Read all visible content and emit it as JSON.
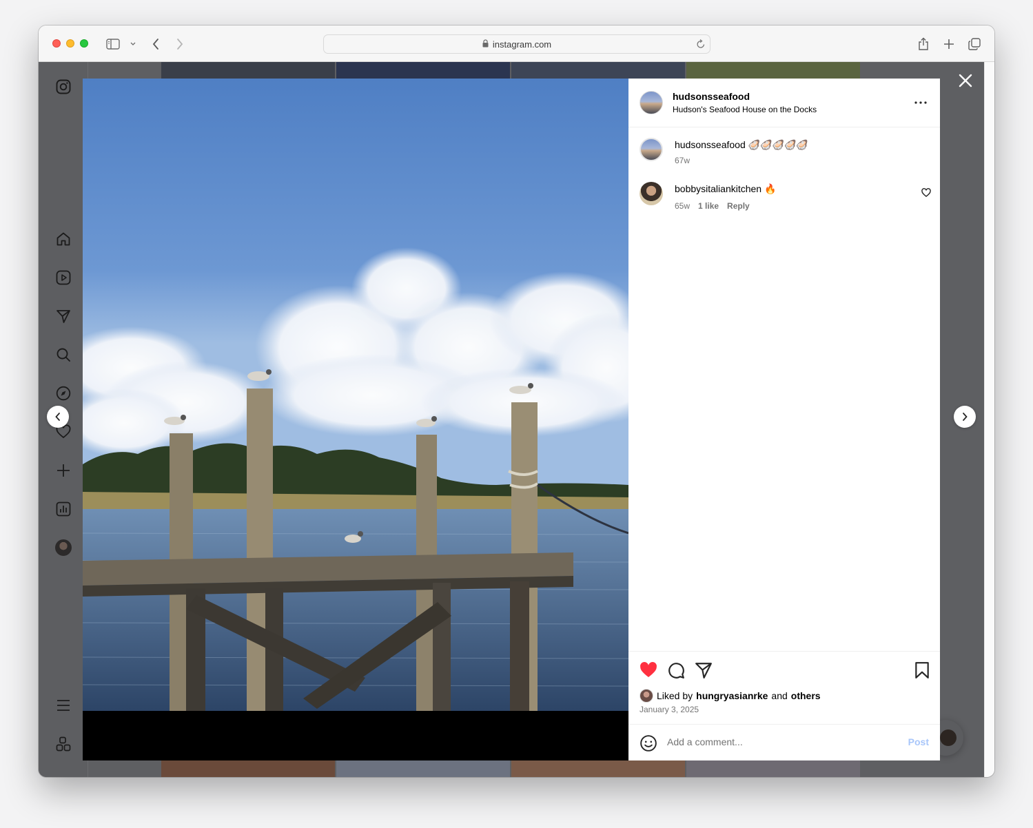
{
  "browser": {
    "url": "instagram.com"
  },
  "post": {
    "header": {
      "username": "hudsonsseafood",
      "location": "Hudson's Seafood House on the Docks"
    },
    "caption": {
      "username": "hudsonsseafood",
      "text": "🦪🦪🦪🦪🦪",
      "time": "67w"
    },
    "comments": [
      {
        "username": "bobbysitaliankitchen",
        "text": "🔥",
        "time": "65w",
        "likes": "1 like",
        "reply": "Reply"
      }
    ],
    "liked_by": {
      "prefix": "Liked by",
      "user": "hungryasianrke",
      "connector": "and",
      "others": "others"
    },
    "date": "January 3, 2025",
    "comment_placeholder": "Add a comment...",
    "post_label": "Post"
  },
  "colors": {
    "like_red": "#ff3040",
    "post_disabled": "#a8c6fa",
    "overlay": "#5e5f62"
  },
  "icons": {
    "sidebar": [
      "instagram-logo-icon",
      "home-icon",
      "reels-icon",
      "direct-icon",
      "search-icon",
      "explore-icon",
      "heart-icon",
      "create-icon",
      "insights-icon",
      "profile-avatar",
      "menu-icon",
      "more-apps-icon"
    ]
  }
}
